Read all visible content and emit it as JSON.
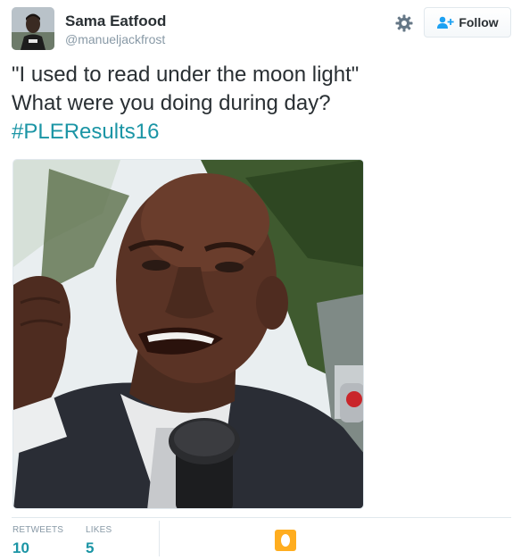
{
  "author": {
    "display_name": "Sama Eatfood",
    "handle": "@manueljackfrost"
  },
  "actions": {
    "follow_label": "Follow"
  },
  "tweet": {
    "line1": "\"I used to read under the moon light\"",
    "line2": "What were you doing during day?",
    "hashtag": "#PLEResults16"
  },
  "stats": {
    "retweets_label": "RETWEETS",
    "retweets_count": "10",
    "likes_label": "LIKES",
    "likes_count": "5"
  },
  "colors": {
    "text": "#292f33",
    "muted": "#8899a6",
    "link": "#1b95a5",
    "follow_icon": "#1da1f2",
    "border": "#e1e8ed",
    "liker_avatar": "#ffad1f"
  },
  "icons": {
    "settings": "gear-icon",
    "follow": "follow-person-plus-icon"
  }
}
